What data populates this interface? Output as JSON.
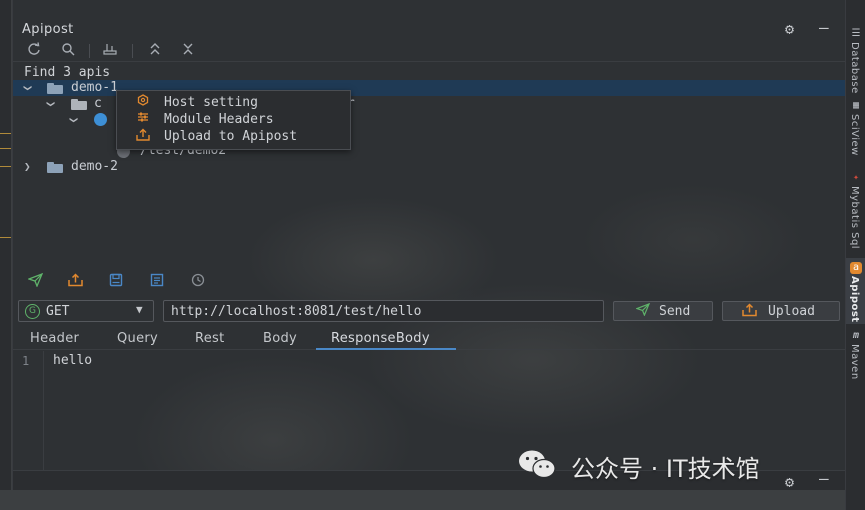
{
  "panel": {
    "title": "Apipost"
  },
  "toolbar": {
    "icons": [
      "refresh-icon",
      "search-icon",
      "tree-icon",
      "expand-icon",
      "collapse-icon"
    ]
  },
  "tree": {
    "summary": "Find 3 apis",
    "nodes": [
      {
        "label": "demo-1",
        "expanded": true,
        "selected": true
      },
      {
        "label": "c",
        "hidden_suffix": "er",
        "expanded": true
      },
      {
        "label": "",
        "expanded": true
      },
      {
        "label": "/test/demo2"
      },
      {
        "label": "demo-2",
        "expanded": false
      }
    ]
  },
  "context_menu": {
    "items": [
      {
        "label": "Host setting",
        "icon": "hexagon-gear-icon"
      },
      {
        "label": "Module Headers",
        "icon": "sliders-icon"
      },
      {
        "label": "Upload to Apipost",
        "icon": "upload-icon"
      }
    ]
  },
  "actions": {
    "icons": [
      "send-icon",
      "upload-icon",
      "save-icon",
      "doc-icon",
      "history-icon"
    ]
  },
  "request": {
    "method_badge": "G",
    "method": "GET",
    "url": "http://localhost:8081/test/hello",
    "send_label": "Send",
    "upload_label": "Upload"
  },
  "tabs": [
    {
      "label": "Header"
    },
    {
      "label": "Query"
    },
    {
      "label": "Rest"
    },
    {
      "label": "Body"
    },
    {
      "label": "ResponseBody",
      "active": true
    }
  ],
  "editor": {
    "line_number": "1",
    "content": "hello"
  },
  "right_sidebar": [
    {
      "label": "Database"
    },
    {
      "label": "SciView"
    },
    {
      "label": "Mybatis Sql"
    },
    {
      "label": "Apipost",
      "active": true
    },
    {
      "label": "Maven"
    }
  ],
  "watermark": {
    "text": "公众号 · IT技术馆"
  },
  "colors": {
    "accent_blue": "#4a88c7",
    "accent_orange": "#e2892f",
    "method_green": "#5fb36a",
    "selection": "#1f3a55"
  }
}
